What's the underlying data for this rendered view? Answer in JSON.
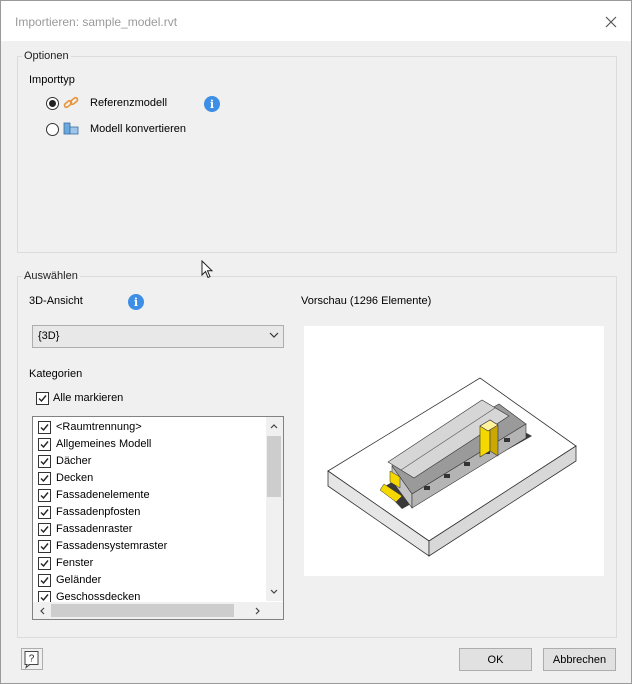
{
  "window": {
    "title": "Importieren: sample_model.rvt",
    "close_glyph": "×"
  },
  "options": {
    "group_label": "Optionen",
    "import_type_label": "Importtyp",
    "reference_model_label": "Referenzmodell",
    "convert_model_label": "Modell konvertieren",
    "selected_option": "Referenzmodell",
    "info_glyph": "i",
    "reference_icon": "link-icon",
    "convert_icon": "model-blocks-icon"
  },
  "select": {
    "group_label": "Auswählen",
    "view_label": "3D-Ansicht",
    "view_value": "{3D}",
    "categories_label": "Kategorien",
    "select_all_label": "Alle markieren",
    "select_all_checked": true,
    "preview_label": "Vorschau (1296 Elemente)",
    "categories": [
      {
        "label": "<Raumtrennung>",
        "checked": true
      },
      {
        "label": "Allgemeines Modell",
        "checked": true
      },
      {
        "label": "Dächer",
        "checked": true
      },
      {
        "label": "Decken",
        "checked": true
      },
      {
        "label": "Fassadenelemente",
        "checked": true
      },
      {
        "label": "Fassadenpfosten",
        "checked": true
      },
      {
        "label": "Fassadenraster",
        "checked": true
      },
      {
        "label": "Fassadensystemraster",
        "checked": true
      },
      {
        "label": "Fenster",
        "checked": true
      },
      {
        "label": "Geländer",
        "checked": true
      },
      {
        "label": "Geschossdecken",
        "checked": true
      }
    ]
  },
  "footer": {
    "help_glyph": "?",
    "ok_label": "OK",
    "cancel_label": "Abbrechen"
  },
  "colors": {
    "info_blue": "#3c8ee6",
    "link_orange": "#e8943a",
    "highlight_yellow": "#f5d800"
  }
}
